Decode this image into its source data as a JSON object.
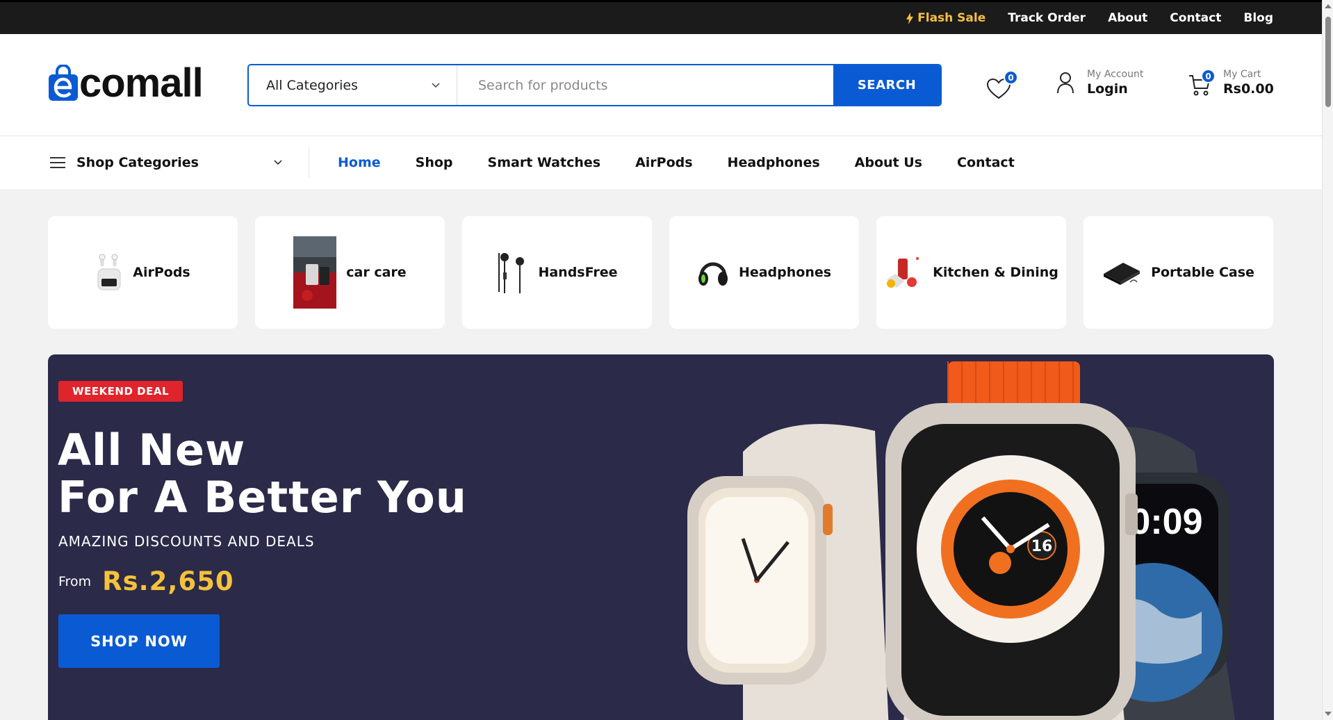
{
  "topbar": {
    "links": [
      "Flash Sale",
      "Track Order",
      "About",
      "Contact",
      "Blog"
    ]
  },
  "header": {
    "logo_text": "comall",
    "category_select": "All Categories",
    "search_placeholder": "Search for products",
    "search_button": "SEARCH",
    "wishlist_count": "0",
    "account_small": "My Account",
    "account_big": "Login",
    "cart_count": "0",
    "cart_small": "My Cart",
    "cart_total": "Rs0.00"
  },
  "nav": {
    "shop_categories": "Shop Categories",
    "items": [
      "Home",
      "Shop",
      "Smart Watches",
      "AirPods",
      "Headphones",
      "About Us",
      "Contact"
    ]
  },
  "categories": [
    {
      "label": "AirPods",
      "icon": "airpods-thumb"
    },
    {
      "label": "car care",
      "icon": "car-care-thumb"
    },
    {
      "label": "HandsFree",
      "icon": "earphones-thumb"
    },
    {
      "label": "Headphones",
      "icon": "headphones-thumb"
    },
    {
      "label": "Kitchen & Dining",
      "icon": "kitchen-thumb"
    },
    {
      "label": "Portable Case",
      "icon": "portable-case-thumb"
    }
  ],
  "hero": {
    "badge": "WEEKEND DEAL",
    "title_line1": "All New",
    "title_line2": "For A Better You",
    "subtitle": "AMAZING DISCOUNTS AND DEALS",
    "from": "From",
    "price": "Rs.2,650",
    "cta": "SHOP NOW",
    "watch_time": "10:09",
    "watch_num": "16"
  },
  "colors": {
    "brand_blue": "#0a5bd3",
    "flash_yellow": "#f6c03f",
    "hero_bg": "#2b2a49",
    "deal_red": "#e0242b",
    "price_yellow": "#f6c23c"
  }
}
